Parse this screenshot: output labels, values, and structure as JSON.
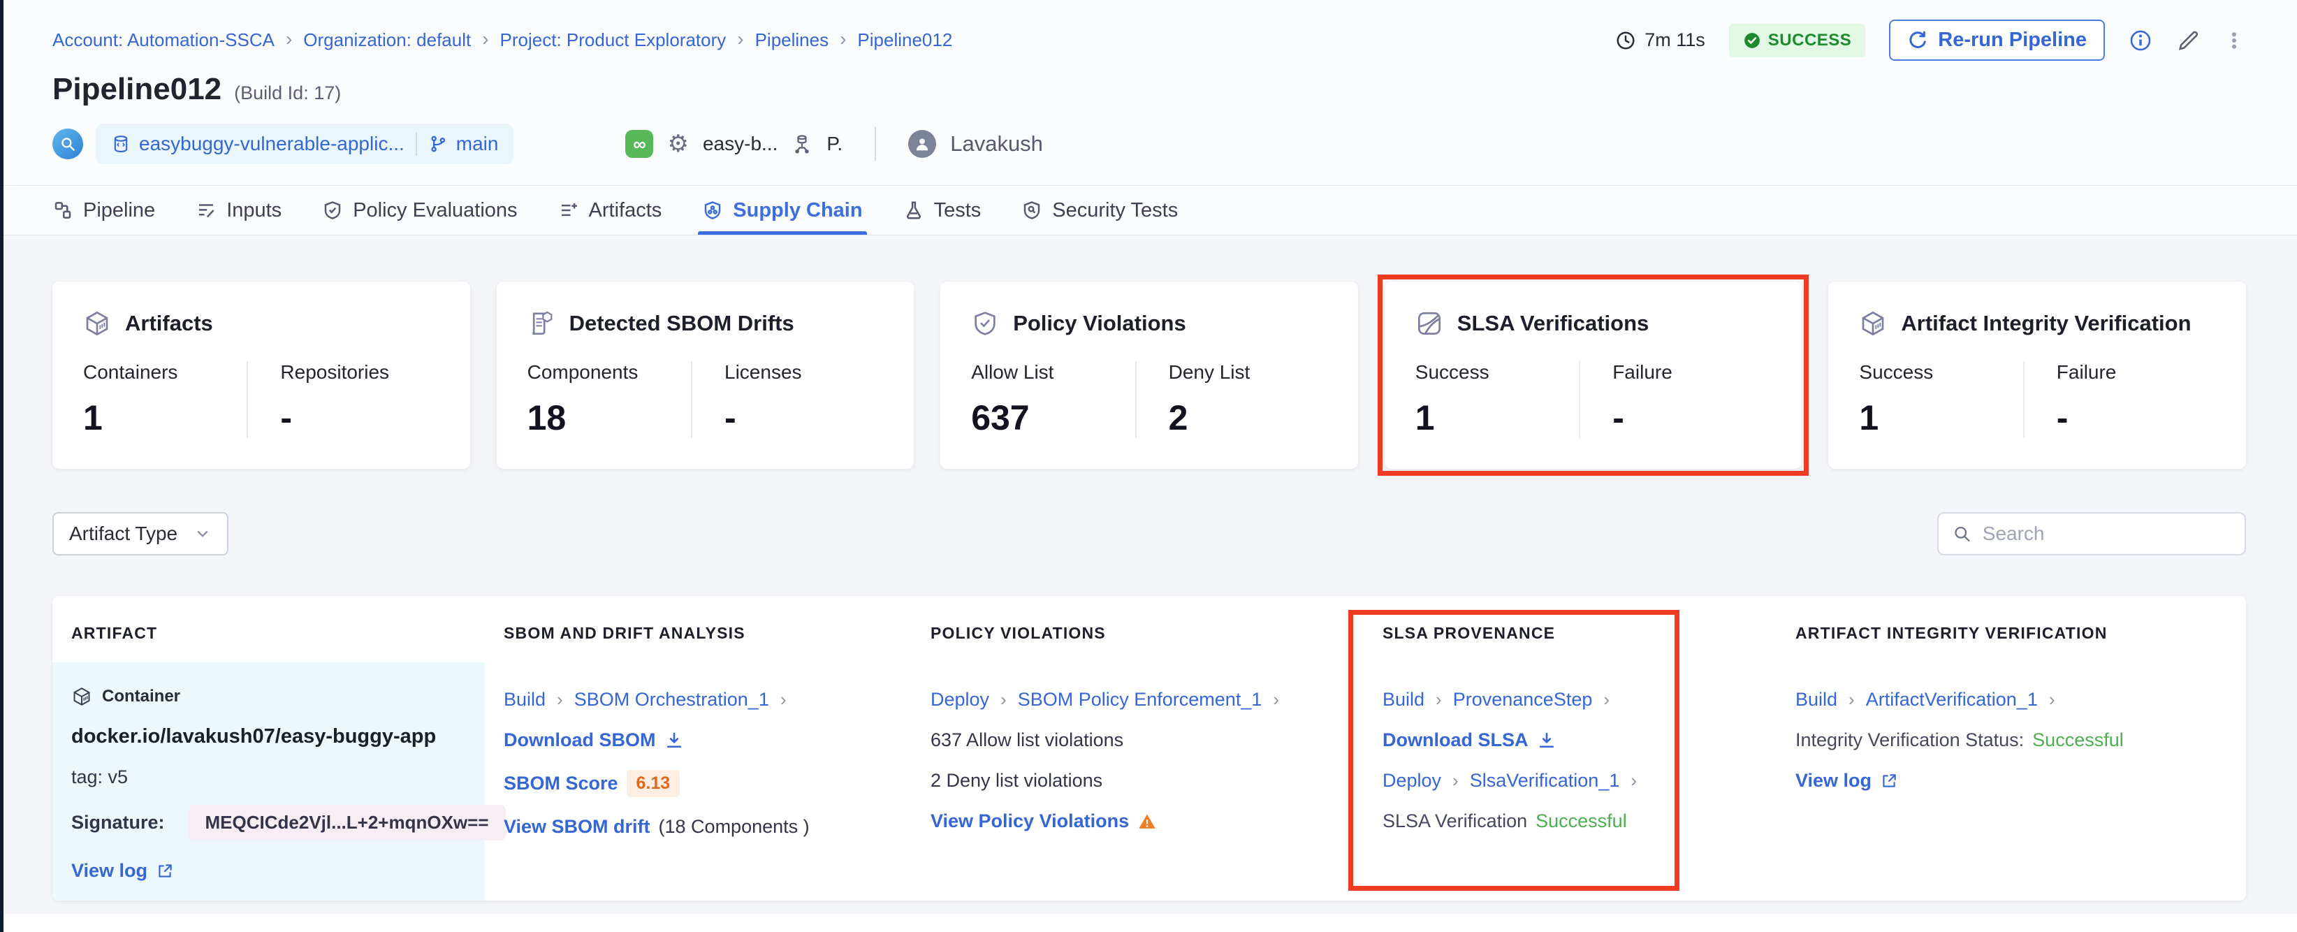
{
  "colors": {
    "accent_blue": "#3566d6",
    "active_tab_blue": "#3b6ee0",
    "success_green": "#4caf50",
    "badge_green_text": "#1d8a2e",
    "badge_green_bg": "#e3f7e5",
    "highlight_red": "#ee3b22",
    "score_orange": "#e0681f",
    "artifact_cell_bg": "#ecf8fc"
  },
  "icons": {
    "clock": "clock-icon",
    "check": "check-circle-icon",
    "refresh": "refresh-icon",
    "info": "info-icon",
    "edit": "pencil-icon",
    "menu": "kebab-icon",
    "gear_glyph": "⚙",
    "infinity_glyph": "∞",
    "separator_glyph": "›",
    "warning_glyph": "⚠"
  },
  "breadcrumb": {
    "items": [
      "Account: Automation-SSCA",
      "Organization: default",
      "Project: Product Exploratory",
      "Pipelines",
      "Pipeline012"
    ]
  },
  "run_meta": {
    "duration": "7m 11s",
    "status": "SUCCESS",
    "rerun_label": "Re-run Pipeline"
  },
  "title": {
    "name": "Pipeline012",
    "build_id": "(Build Id: 17)"
  },
  "context_bar": {
    "repo": "easybuggy-vulnerable-applic...",
    "branch": "main",
    "trigger": "easy-b...",
    "initial": "P.",
    "user": "Lavakush"
  },
  "tabs": [
    {
      "label": "Pipeline",
      "active": false
    },
    {
      "label": "Inputs",
      "active": false
    },
    {
      "label": "Policy Evaluations",
      "active": false
    },
    {
      "label": "Artifacts",
      "active": false
    },
    {
      "label": "Supply Chain",
      "active": true
    },
    {
      "label": "Tests",
      "active": false
    },
    {
      "label": "Security Tests",
      "active": false
    }
  ],
  "summary_cards": [
    {
      "title": "Artifacts",
      "icon": "cube-icon",
      "highlighted": false,
      "stats": [
        {
          "label": "Containers",
          "value": "1"
        },
        {
          "label": "Repositories",
          "value": "-"
        }
      ]
    },
    {
      "title": "Detected SBOM Drifts",
      "icon": "sbom-document-icon",
      "highlighted": false,
      "stats": [
        {
          "label": "Components",
          "value": "18"
        },
        {
          "label": "Licenses",
          "value": "-"
        }
      ]
    },
    {
      "title": "Policy Violations",
      "icon": "shield-check-icon",
      "highlighted": false,
      "stats": [
        {
          "label": "Allow List",
          "value": "637"
        },
        {
          "label": "Deny List",
          "value": "2"
        }
      ]
    },
    {
      "title": "SLSA Verifications",
      "icon": "slsa-icon",
      "highlighted": true,
      "stats": [
        {
          "label": "Success",
          "value": "1"
        },
        {
          "label": "Failure",
          "value": "-"
        }
      ]
    },
    {
      "title": "Artifact Integrity Verification",
      "icon": "cube-icon",
      "highlighted": false,
      "stats": [
        {
          "label": "Success",
          "value": "1"
        },
        {
          "label": "Failure",
          "value": "-"
        }
      ]
    }
  ],
  "filters": {
    "artifact_type_label": "Artifact Type",
    "search_placeholder": "Search"
  },
  "table": {
    "headers": [
      "ARTIFACT",
      "SBOM AND DRIFT ANALYSIS",
      "POLICY VIOLATIONS",
      "SLSA PROVENANCE",
      "ARTIFACT INTEGRITY VERIFICATION"
    ],
    "row": {
      "artifact": {
        "type": "Container",
        "name": "docker.io/lavakush07/easy-buggy-app",
        "tag": "tag: v5",
        "signature_label": "Signature:",
        "signature": "MEQCICde2Vjl...L+2+mqnOXw==",
        "view_log": "View log"
      },
      "sbom": {
        "stage": "Build",
        "step": "SBOM Orchestration_1",
        "download": "Download SBOM",
        "score_label": "SBOM Score",
        "score": "6.13",
        "drift_link": "View SBOM drift",
        "drift_note": "(18 Components )"
      },
      "policy": {
        "stage": "Deploy",
        "step": "SBOM Policy Enforcement_1",
        "allow": "637 Allow list violations",
        "deny": "2 Deny list violations",
        "view": "View Policy Violations"
      },
      "slsa": {
        "stage1": "Build",
        "step1": "ProvenanceStep",
        "download": "Download SLSA",
        "stage2": "Deploy",
        "step2": "SlsaVerification_1",
        "status_label": "SLSA Verification",
        "status": "Successful"
      },
      "integrity": {
        "stage": "Build",
        "step": "ArtifactVerification_1",
        "status_label": "Integrity Verification Status:",
        "status": "Successful",
        "view_log": "View log"
      }
    }
  }
}
